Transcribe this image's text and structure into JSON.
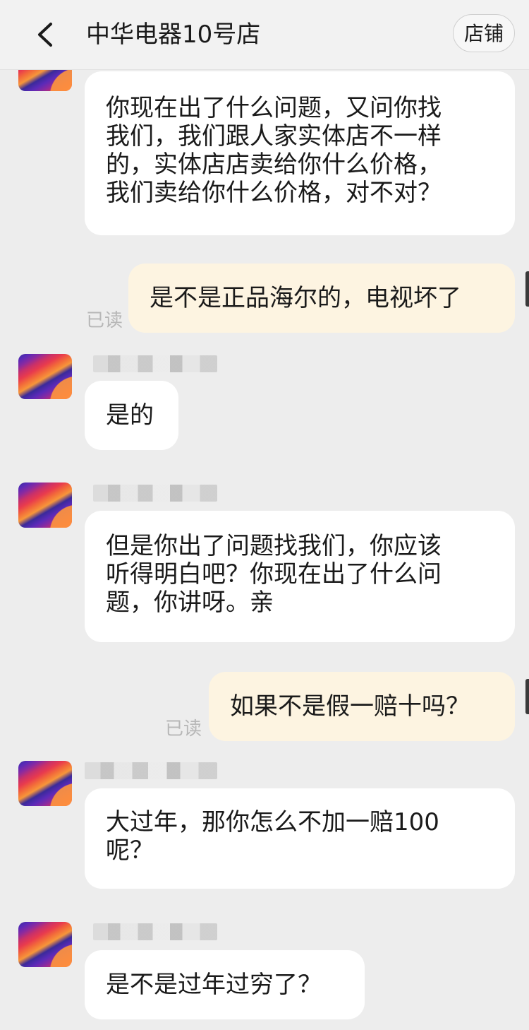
{
  "header": {
    "title": "中华电器10号店",
    "shop_button": "店铺",
    "back_icon": "chevron-left-icon"
  },
  "messages": [
    {
      "from": "shop",
      "text": "你现在出了什么问题，又问你找\n我们，我们跟人家实体店不一样\n的，实体店店卖给你什么价格，\n我们卖给你什么价格，对不对？"
    },
    {
      "from": "me",
      "text": "是不是正品海尔的，电视坏了",
      "status": "已读"
    },
    {
      "from": "shop",
      "text": "是的"
    },
    {
      "from": "shop",
      "text": "但是你出了问题找我们，你应该\n听得明白吧？你现在出了什么问\n题，你讲呀。亲"
    },
    {
      "from": "me",
      "text": "如果不是假一赔十吗？",
      "status": "已读"
    },
    {
      "from": "shop",
      "text": "大过年，那你怎么不加一赔100\n呢？"
    },
    {
      "from": "shop",
      "text": "是不是过年过穷了？"
    }
  ],
  "colors": {
    "background": "#ededed",
    "shop_bubble": "#ffffff",
    "my_bubble": "#fdf4e1",
    "read_status": "#b7b7b7"
  }
}
